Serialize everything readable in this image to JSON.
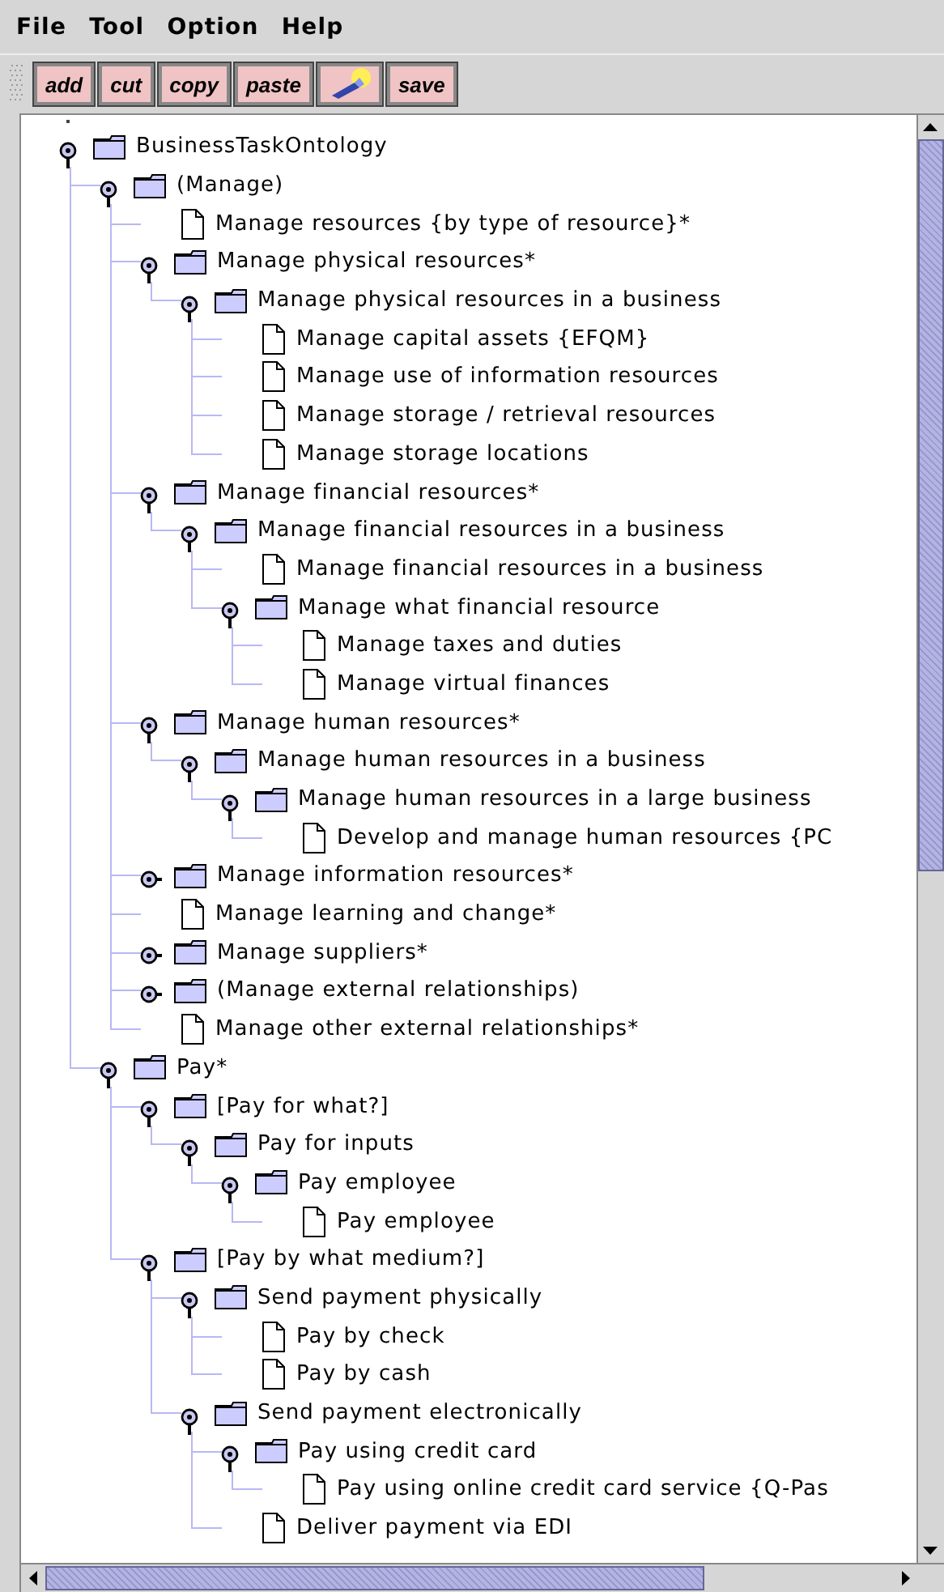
{
  "menu": [
    "File",
    "Tool",
    "Option",
    "Help"
  ],
  "toolbar": [
    {
      "kind": "text",
      "label": "add"
    },
    {
      "kind": "text",
      "label": "cut"
    },
    {
      "kind": "text",
      "label": "copy"
    },
    {
      "kind": "text",
      "label": "paste"
    },
    {
      "kind": "icon"
    },
    {
      "kind": "text",
      "label": "save"
    }
  ],
  "tree": [
    {
      "kind": "folder",
      "label": "BusinessTaskOntology",
      "expanded": true,
      "children": [
        {
          "kind": "folder",
          "label": "(Manage)",
          "expanded": true,
          "children": [
            {
              "kind": "leaf",
              "label": "Manage resources {by type of resource}*"
            },
            {
              "kind": "folder",
              "label": "Manage physical resources*",
              "expanded": true,
              "children": [
                {
                  "kind": "folder",
                  "label": "Manage physical resources in a business",
                  "expanded": true,
                  "children": [
                    {
                      "kind": "leaf",
                      "label": "Manage capital assets {EFQM}"
                    },
                    {
                      "kind": "leaf",
                      "label": "Manage use of information resources"
                    },
                    {
                      "kind": "leaf",
                      "label": "Manage storage / retrieval resources"
                    },
                    {
                      "kind": "leaf",
                      "label": "Manage storage locations"
                    }
                  ]
                }
              ]
            },
            {
              "kind": "folder",
              "label": "Manage financial resources*",
              "expanded": true,
              "children": [
                {
                  "kind": "folder",
                  "label": "Manage financial resources in a business",
                  "expanded": true,
                  "children": [
                    {
                      "kind": "leaf",
                      "label": "Manage financial resources in a business"
                    },
                    {
                      "kind": "folder",
                      "label": "Manage what financial resource",
                      "expanded": true,
                      "children": [
                        {
                          "kind": "leaf",
                          "label": "Manage taxes and duties"
                        },
                        {
                          "kind": "leaf",
                          "label": "Manage virtual finances"
                        }
                      ]
                    }
                  ]
                }
              ]
            },
            {
              "kind": "folder",
              "label": "Manage human resources*",
              "expanded": true,
              "children": [
                {
                  "kind": "folder",
                  "label": "Manage human resources in a business",
                  "expanded": true,
                  "children": [
                    {
                      "kind": "folder",
                      "label": "Manage human resources in a large business",
                      "expanded": true,
                      "children": [
                        {
                          "kind": "leaf",
                          "label": "Develop and manage human resources {PC"
                        }
                      ]
                    }
                  ]
                }
              ]
            },
            {
              "kind": "folder",
              "label": "Manage information resources*",
              "expanded": false
            },
            {
              "kind": "leaf",
              "label": "Manage learning and change*"
            },
            {
              "kind": "folder",
              "label": "Manage suppliers*",
              "expanded": false
            },
            {
              "kind": "folder",
              "label": "(Manage external relationships)",
              "expanded": false
            },
            {
              "kind": "leaf",
              "label": "Manage other external relationships*"
            }
          ]
        },
        {
          "kind": "folder",
          "label": "Pay*",
          "expanded": true,
          "children": [
            {
              "kind": "folder",
              "label": "[Pay for what?]",
              "expanded": true,
              "children": [
                {
                  "kind": "folder",
                  "label": "Pay for inputs",
                  "expanded": true,
                  "children": [
                    {
                      "kind": "folder",
                      "label": "Pay employee",
                      "expanded": true,
                      "children": [
                        {
                          "kind": "leaf",
                          "label": "Pay employee"
                        }
                      ]
                    }
                  ]
                }
              ]
            },
            {
              "kind": "folder",
              "label": "[Pay by what medium?]",
              "expanded": true,
              "children": [
                {
                  "kind": "folder",
                  "label": "Send payment physically",
                  "expanded": true,
                  "children": [
                    {
                      "kind": "leaf",
                      "label": "Pay by check"
                    },
                    {
                      "kind": "leaf",
                      "label": "Pay by cash"
                    }
                  ]
                },
                {
                  "kind": "folder",
                  "label": "Send payment electronically",
                  "expanded": true,
                  "children": [
                    {
                      "kind": "folder",
                      "label": "Pay using credit card",
                      "expanded": true,
                      "children": [
                        {
                          "kind": "leaf",
                          "label": "Pay using online credit card service {Q-Pas"
                        }
                      ]
                    },
                    {
                      "kind": "leaf",
                      "label": "Deliver payment via EDI"
                    }
                  ]
                }
              ]
            }
          ]
        }
      ]
    }
  ]
}
